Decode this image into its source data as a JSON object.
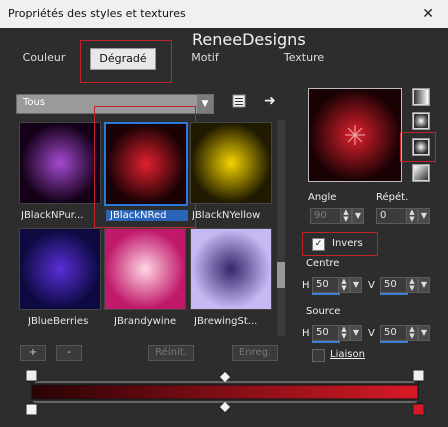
{
  "window": {
    "title": "Propriétés des styles et textures",
    "close_glyph": "✕"
  },
  "brand": "ReneeDesigns",
  "tabs": [
    {
      "label": "Couleur"
    },
    {
      "label": "Dégradé"
    },
    {
      "label": "Motif"
    },
    {
      "label": "Texture"
    }
  ],
  "category": {
    "selected": "Tous"
  },
  "gradients": [
    {
      "label": "JBlackNPur...",
      "inner": "#a44ad0",
      "outer": "#140018"
    },
    {
      "label": "JBlackNRed",
      "inner": "#e0202e",
      "outer": "#1a0204"
    },
    {
      "label": "JBlackNYellow",
      "inner": "#f4d400",
      "outer": "#201a00"
    },
    {
      "label": "JBlueBerries",
      "inner": "#5a2ed8",
      "outer": "#0c0a40"
    },
    {
      "label": "JBrandywine",
      "inner": "#ffd6e4",
      "outer": "#c0186a"
    },
    {
      "label": "JBrewingSt...",
      "inner": "#34266a",
      "outer": "#c6b8f2"
    }
  ],
  "buttons": {
    "add": "+",
    "remove": "-",
    "reset": "Réinit.",
    "save": "Enreg."
  },
  "controls": {
    "angle_label": "Angle",
    "angle_value": "90",
    "repeat_label": "Répét.",
    "repeat_value": "0",
    "invert_label": "Invers",
    "invert_checked": true,
    "centre_label": "Centre",
    "centre_h_label": "H",
    "centre_h": "50",
    "centre_v_label": "V",
    "centre_v": "50",
    "source_label": "Source",
    "source_h_label": "H",
    "source_h": "50",
    "source_v_label": "V",
    "source_v": "50",
    "link_label": "Liaison"
  },
  "colors": {
    "accent": "#3a7fd5",
    "highlight_red": "#c0232a",
    "gradient_start": "#d81a26",
    "gradient_end": "#2a0205"
  }
}
